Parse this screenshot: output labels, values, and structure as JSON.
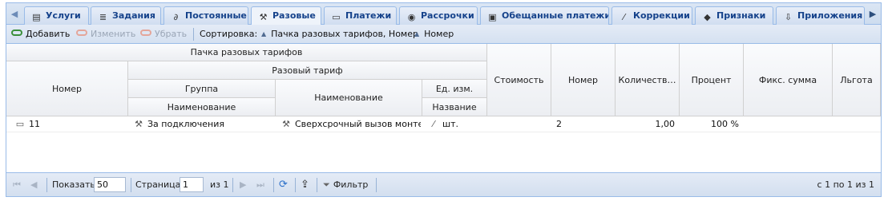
{
  "tabs": [
    {
      "label": "Услуги",
      "icon": "document-icon",
      "active": false
    },
    {
      "label": "Задания",
      "icon": "tasks-icon",
      "active": false
    },
    {
      "label": "Постоянные",
      "icon": "link-icon",
      "active": false
    },
    {
      "label": "Разовые",
      "icon": "wrench-icon",
      "active": true
    },
    {
      "label": "Платежи",
      "icon": "card-icon",
      "active": false
    },
    {
      "label": "Рассрочки",
      "icon": "lifebuoy-icon",
      "active": false
    },
    {
      "label": "Обещанные платежи",
      "icon": "promise-icon",
      "active": false
    },
    {
      "label": "Коррекции",
      "icon": "magic-wand-icon",
      "active": false
    },
    {
      "label": "Признаки",
      "icon": "tag-icon",
      "active": false
    },
    {
      "label": "Приложения",
      "icon": "attachment-icon",
      "active": false
    }
  ],
  "toolbar": {
    "add_label": "Добавить",
    "edit_label": "Изменить",
    "remove_label": "Убрать",
    "sort_label": "Сортировка:",
    "sort_items": [
      "Пачка разовых тарифов, Номер",
      "Номер"
    ]
  },
  "grid": {
    "headers": {
      "pack": "Пачка разовых тарифов",
      "number": "Номер",
      "tariff": "Разовый тариф",
      "group": "Группа",
      "group_name": "Наименование",
      "tariff_name": "Наименование",
      "unit": "Ед. изм.",
      "unit_name": "Название",
      "cost": "Стоимость",
      "number2": "Номер",
      "quantity": "Количеств…",
      "percent": "Процент",
      "fixed_sum": "Фикс. сумма",
      "benefit": "Льгота"
    },
    "rows": [
      {
        "number": "11",
        "group_name": "За подключения",
        "tariff_name": "Сверхсрочный вызов монте…",
        "unit_name": "шт.",
        "cost": "",
        "number2": "2",
        "quantity": "1,00",
        "percent": "100 %",
        "fixed_sum": "",
        "benefit": ""
      }
    ]
  },
  "pager": {
    "show_label": "Показать",
    "page_size": "50",
    "page_label": "Страница",
    "page_value": "1",
    "of_label": "из 1",
    "filter_label": "Фильтр",
    "summary": "с 1 по 1 из 1"
  }
}
